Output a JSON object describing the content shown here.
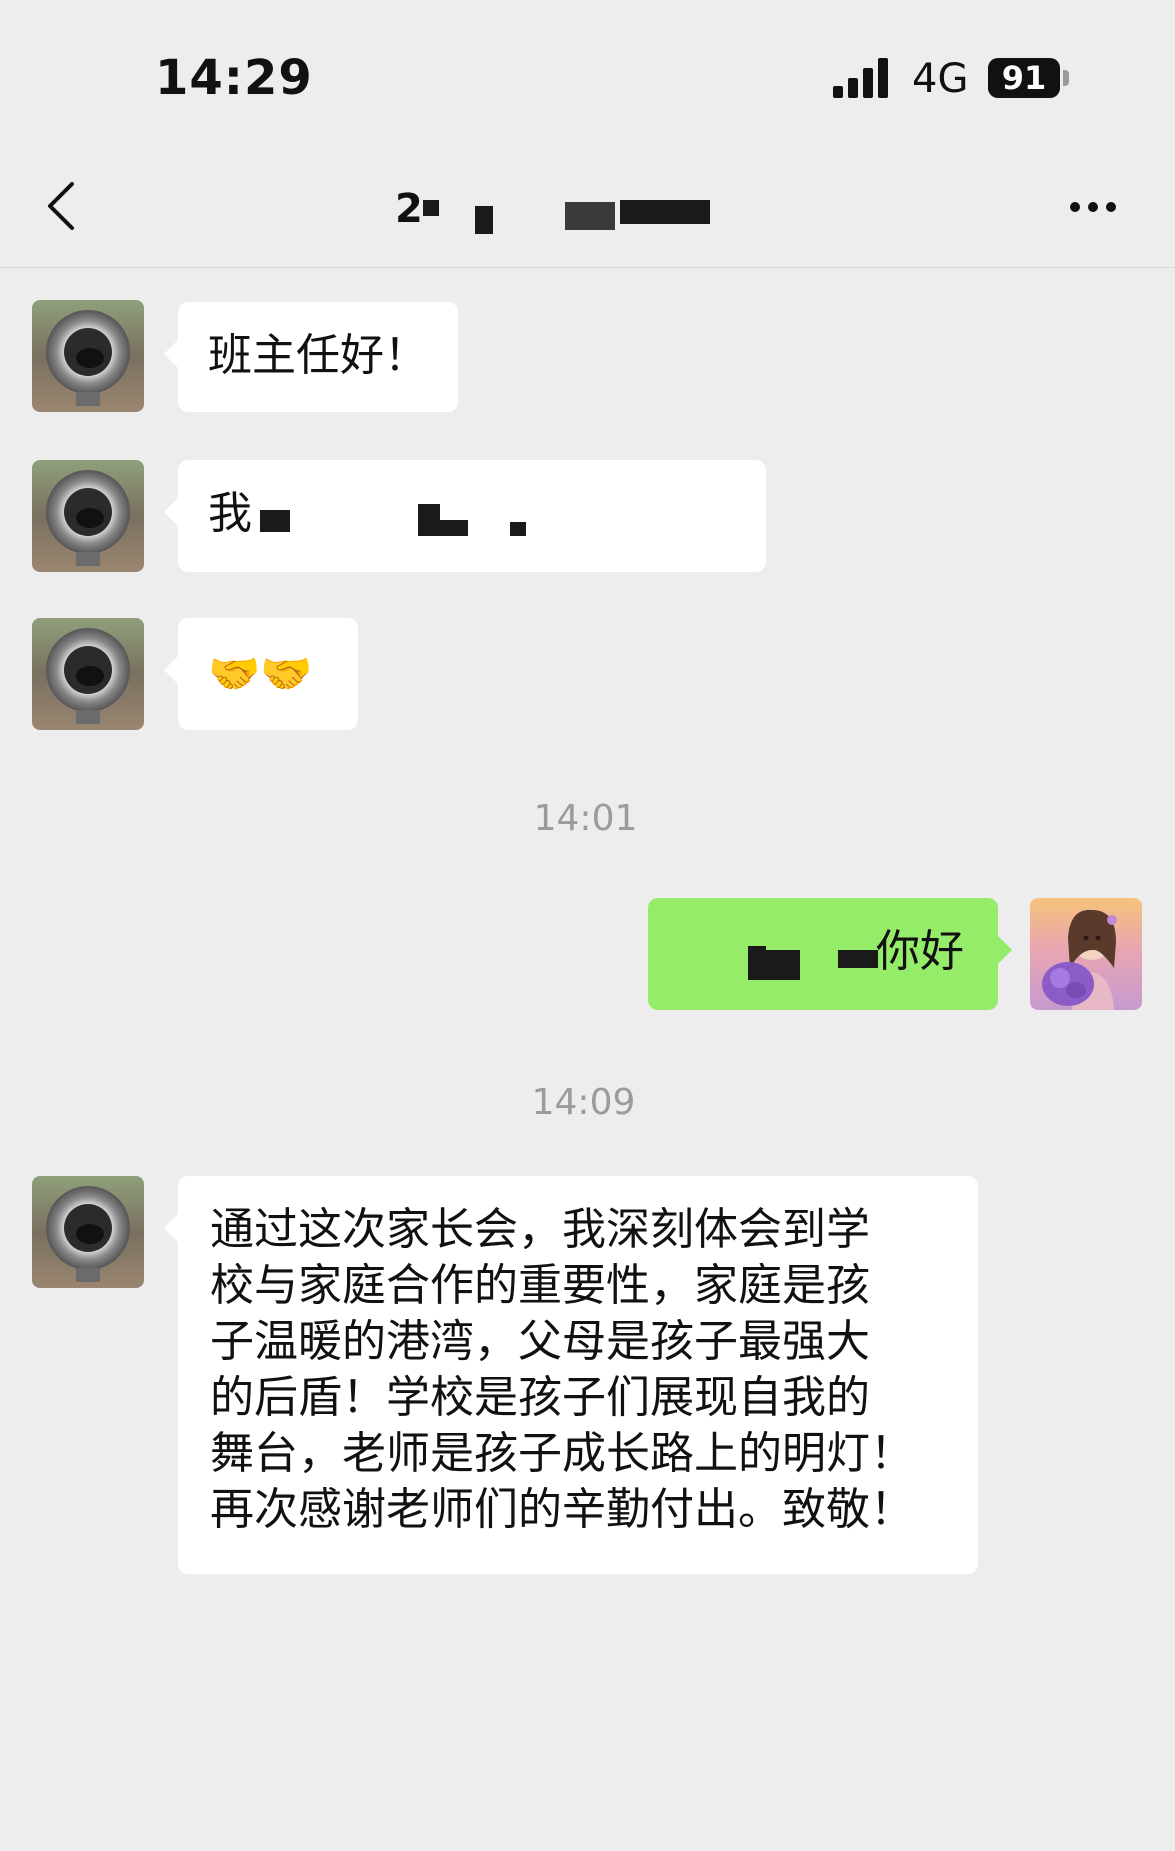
{
  "status_bar": {
    "time": "14:29",
    "network": "4G",
    "battery": "91"
  },
  "nav": {
    "title_visible": "2",
    "more_icon": "more-dots-icon",
    "back_icon": "chevron-left-icon"
  },
  "messages": [
    {
      "sender": "other",
      "text": "班主任好！"
    },
    {
      "sender": "other",
      "text": "我",
      "redacted": true
    },
    {
      "sender": "other",
      "emoji": "🤝🤝"
    },
    {
      "type": "timestamp",
      "text": "14:01"
    },
    {
      "sender": "self",
      "text": "你好",
      "redacted_prefix": true
    },
    {
      "type": "timestamp",
      "text": "14:09"
    },
    {
      "sender": "other",
      "lines": [
        "通过这次家长会，我深刻体会到学",
        "校与家庭合作的重要性，家庭是孩",
        "子温暖的港湾，父母是孩子最强大",
        "的后盾！学校是孩子们展现自我的",
        "舞台，老师是孩子成长路上的明灯！",
        "再次感谢老师们的辛勤付出。致敬！"
      ]
    }
  ],
  "colors": {
    "background": "#ededed",
    "self_bubble": "#95ec69",
    "other_bubble": "#ffffff",
    "timestamp": "#9b9b9b"
  }
}
